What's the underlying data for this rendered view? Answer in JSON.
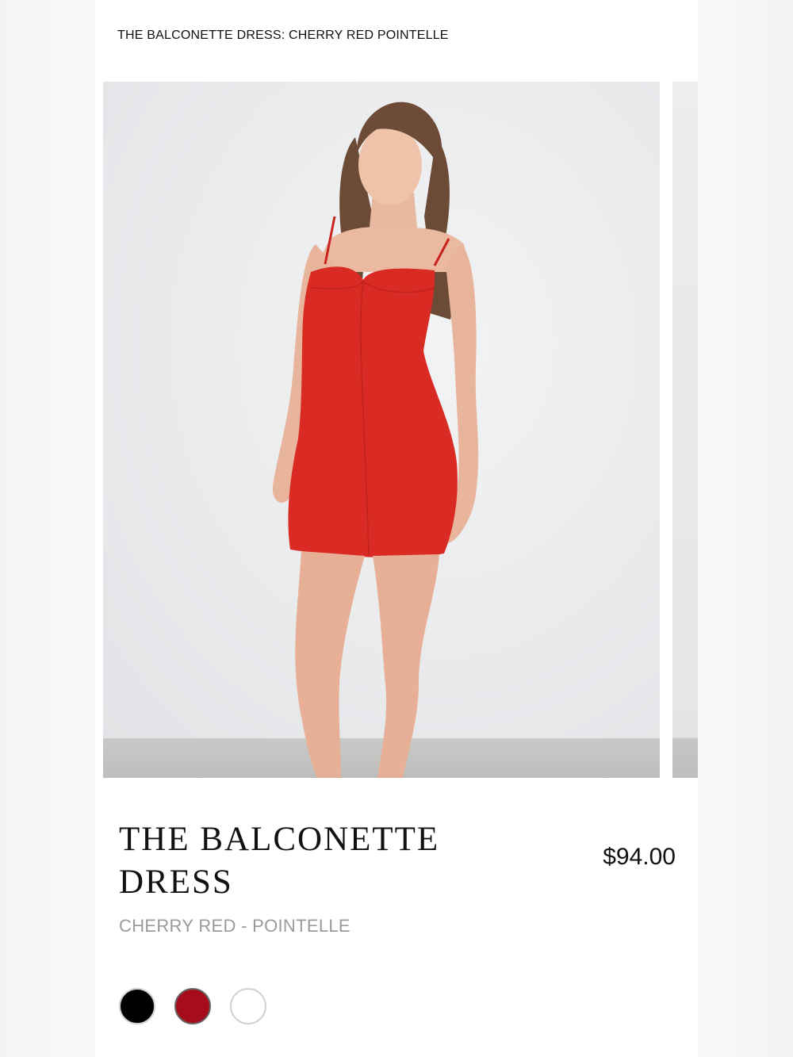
{
  "header": {
    "breadcrumb": "THE BALCONETTE DRESS: CHERRY RED POINTELLE"
  },
  "gallery": {
    "current_image": "model-red-dress-photo",
    "next_image_peek": true
  },
  "product": {
    "title": "THE BALCONETTE DRESS",
    "price": "$94.00",
    "variant": "CHERRY RED - POINTELLE"
  },
  "swatches": [
    {
      "name": "black",
      "color": "#000000",
      "selected": false
    },
    {
      "name": "cherry-red",
      "color": "#a50d1c",
      "selected": true
    },
    {
      "name": "white",
      "color": "#ffffff",
      "selected": false
    }
  ],
  "colors": {
    "dress": "#d92b23",
    "background": "#ffffff",
    "muted_text": "#9a9a9a"
  }
}
